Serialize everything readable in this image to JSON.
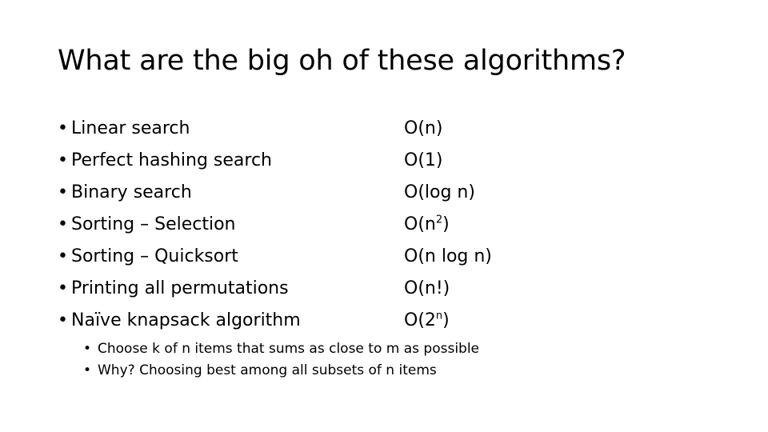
{
  "slide": {
    "title": "What are the big oh of these algorithms?",
    "bullet_char": "•",
    "rows": [
      {
        "label": "Linear search",
        "complexity_prefix": "O(n)",
        "complexity_sup": "",
        "complexity_suffix": ""
      },
      {
        "label": "Perfect hashing search",
        "complexity_prefix": "O(1)",
        "complexity_sup": "",
        "complexity_suffix": ""
      },
      {
        "label": "Binary search",
        "complexity_prefix": "O(log n)",
        "complexity_sup": "",
        "complexity_suffix": ""
      },
      {
        "label": "Sorting – Selection",
        "complexity_prefix": "O(n",
        "complexity_sup": "2",
        "complexity_suffix": ")"
      },
      {
        "label": "Sorting – Quicksort",
        "complexity_prefix": "O(n log n)",
        "complexity_sup": "",
        "complexity_suffix": ""
      },
      {
        "label": "Printing all permutations",
        "complexity_prefix": "O(n!)",
        "complexity_sup": "",
        "complexity_suffix": ""
      },
      {
        "label": "Naïve knapsack algorithm",
        "complexity_prefix": "O(2",
        "complexity_sup": "n",
        "complexity_suffix": ")"
      }
    ],
    "sub_bullets": [
      {
        "text": "Choose k of n items that sums as close to m as possible"
      },
      {
        "text": "Why? Choosing best among all subsets of n items"
      }
    ]
  }
}
